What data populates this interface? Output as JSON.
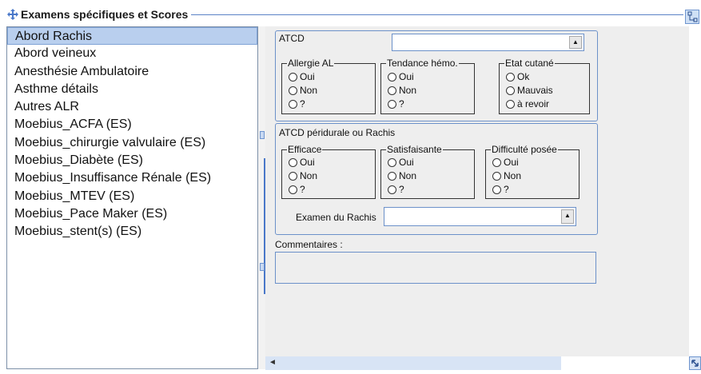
{
  "title": "Examens spécifiques et Scores",
  "list": {
    "items": [
      "Abord Rachis",
      "Abord veineux",
      "Anesthésie Ambulatoire",
      "Asthme détails",
      "Autres ALR",
      "Moebius_ACFA (ES)",
      "Moebius_chirurgie valvulaire (ES)",
      "Moebius_Diabète (ES)",
      "Moebius_Insuffisance Rénale (ES)",
      "Moebius_MTEV (ES)",
      "Moebius_Pace Maker (ES)",
      "Moebius_stent(s) (ES)"
    ],
    "selected_index": 0
  },
  "atcd": {
    "label": "ATCD",
    "combo_value": "",
    "allergie": {
      "legend": "Allergie AL",
      "options": [
        "Oui",
        "Non",
        "?"
      ]
    },
    "tendance": {
      "legend": "Tendance hémo.",
      "options": [
        "Oui",
        "Non",
        "?"
      ]
    },
    "etat": {
      "legend": "Etat cutané",
      "options": [
        "Ok",
        "Mauvais",
        "à revoir"
      ]
    }
  },
  "peridurale": {
    "label": "ATCD péridurale ou Rachis",
    "efficace": {
      "legend": "Efficace",
      "options": [
        "Oui",
        "Non",
        "?"
      ]
    },
    "satisfaisante": {
      "legend": "Satisfaisante",
      "options": [
        "Oui",
        "Non",
        "?"
      ]
    },
    "difficulte": {
      "legend": "Difficulté posée",
      "options": [
        "Oui",
        "Non",
        "?"
      ]
    },
    "examen_label": "Examen du Rachis",
    "examen_value": ""
  },
  "comments": {
    "label": "Commentaires :",
    "value": ""
  },
  "icons": {
    "move": "move-icon",
    "corner": "layout-icon",
    "combo_arrow": "dropdown-arrow-icon",
    "scroll_left": "scroll-left-icon",
    "resize": "resize-grip-icon"
  },
  "colors": {
    "accent": "#5b83c7",
    "selection": "#b9cfee",
    "panel": "#eeeeee"
  }
}
